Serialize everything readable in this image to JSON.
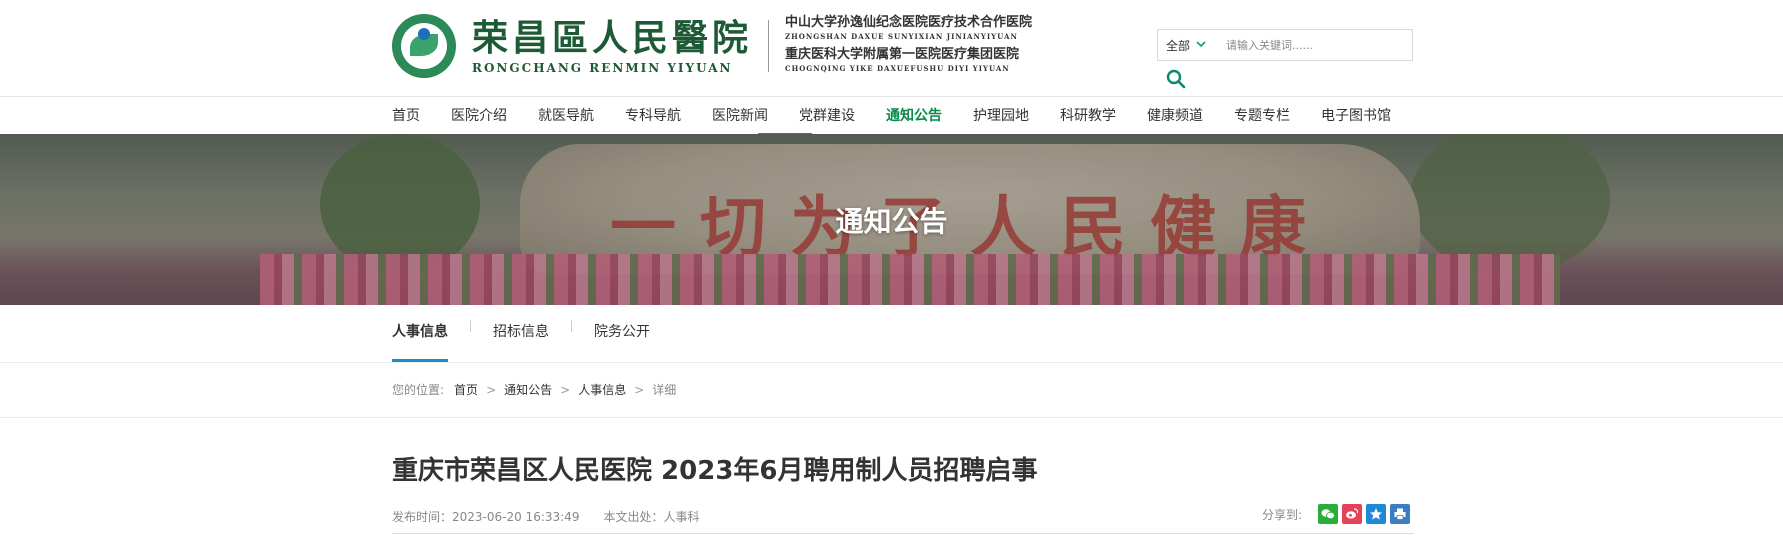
{
  "header": {
    "hospital_name_cn": "荣昌區人民醫院",
    "hospital_name_en": "RONGCHANG RENMIN YIYUAN",
    "affiliation1_cn": "中山大学孙逸仙纪念医院医疗技术合作医院",
    "affiliation1_en": "ZHONGSHAN DAXUE SUNYIXIAN JINIANYIYUAN",
    "affiliation2_cn": "重庆医科大学附属第一医院医疗集团医院",
    "affiliation2_en": "CHOGNQING YIKE DAXUEFUSHU DIYI YIYUAN"
  },
  "search": {
    "scope": "全部",
    "placeholder": "请输入关键词......",
    "button_icon": "search-icon"
  },
  "nav": {
    "items": [
      "首页",
      "医院介绍",
      "就医导航",
      "专科导航",
      "医院新闻",
      "党群建设",
      "通知公告",
      "护理园地",
      "科研教学",
      "健康频道",
      "专题专栏",
      "电子图书馆"
    ],
    "active": "通知公告"
  },
  "banner": {
    "title": "通知公告",
    "calligraphy": "一切为了人民健康"
  },
  "subnav": {
    "items": [
      "人事信息",
      "招标信息",
      "院务公开"
    ],
    "active": "人事信息"
  },
  "breadcrumb": {
    "label": "您的位置:",
    "items": [
      "首页",
      "通知公告",
      "人事信息"
    ],
    "current": "详细"
  },
  "article": {
    "title": "重庆市荣昌区人民医院 2023年6月聘用制人员招聘启事",
    "publish_time": "发布时间：2023-06-20 16:33:49",
    "source": "本文出处：人事科",
    "share_label": "分享到:",
    "share_buttons": [
      {
        "icon": "wechat-icon",
        "color": "#2aae3a"
      },
      {
        "icon": "weibo-icon",
        "color": "#e6415a"
      },
      {
        "icon": "qzone-star-icon",
        "color": "#1e8ad6"
      },
      {
        "icon": "print-icon",
        "color": "#3a7fc4"
      }
    ]
  },
  "colors": {
    "brand_green": "#1e5a36",
    "nav_active": "#0a8a4a",
    "subnav_active": "#1c8acb"
  }
}
